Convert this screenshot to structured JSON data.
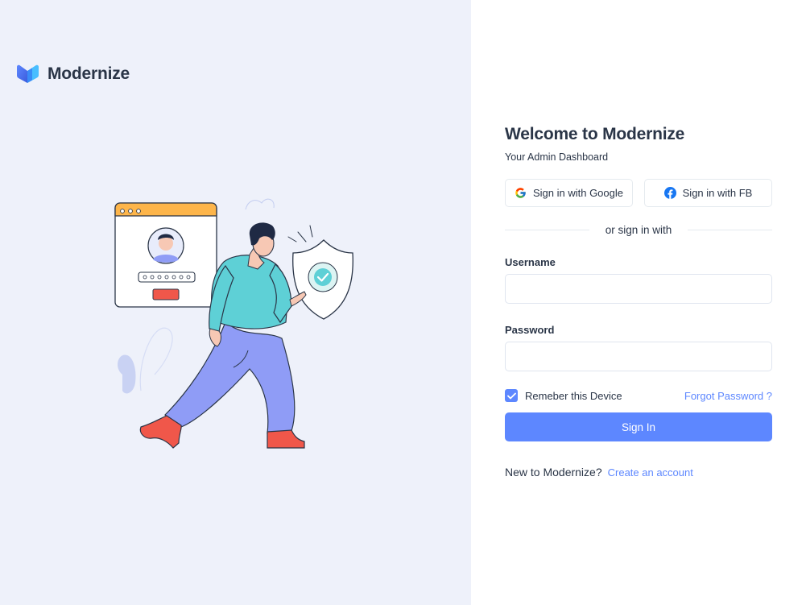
{
  "brand": {
    "name": "Modernize",
    "logo_icon": "modernize-logo-icon"
  },
  "colors": {
    "primary": "#5d87ff",
    "text": "#2a3547",
    "panel_bg": "#eef1fa",
    "border": "#dfe5ef"
  },
  "form": {
    "title": "Welcome to Modernize",
    "subtitle": "Your Admin Dashboard",
    "google_label": "Sign in with Google",
    "facebook_label": "Sign in with FB",
    "divider_text": "or sign in with",
    "username_label": "Username",
    "username_value": "",
    "password_label": "Password",
    "password_value": "",
    "remember_label": "Remeber this Device",
    "remember_checked": true,
    "forgot_label": "Forgot Password ?",
    "signin_label": "Sign In",
    "new_text": "New to Modernize?",
    "create_label": "Create an account"
  }
}
